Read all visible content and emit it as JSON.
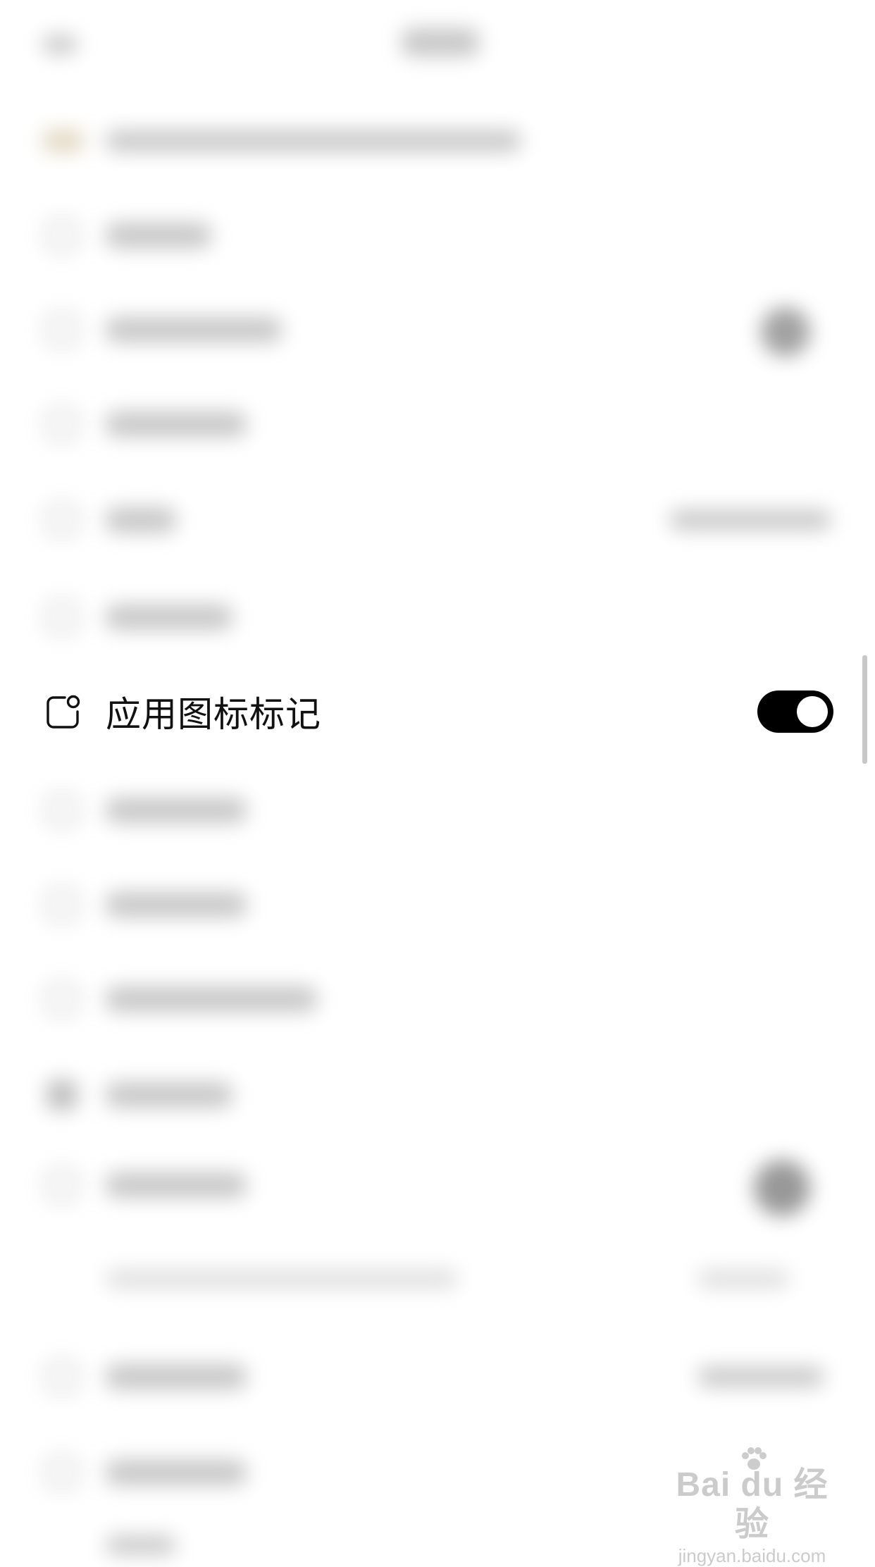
{
  "setting_row": {
    "label": "应用图标标记",
    "icon": "app-badge-icon",
    "toggle_on": true
  },
  "watermark": {
    "brand": "Bai du 经验",
    "url": "jingyan.baidu.com"
  },
  "colors": {
    "toggle_track": "#000000",
    "toggle_knob": "#ffffff",
    "label_text": "#111111",
    "background": "#ffffff"
  }
}
